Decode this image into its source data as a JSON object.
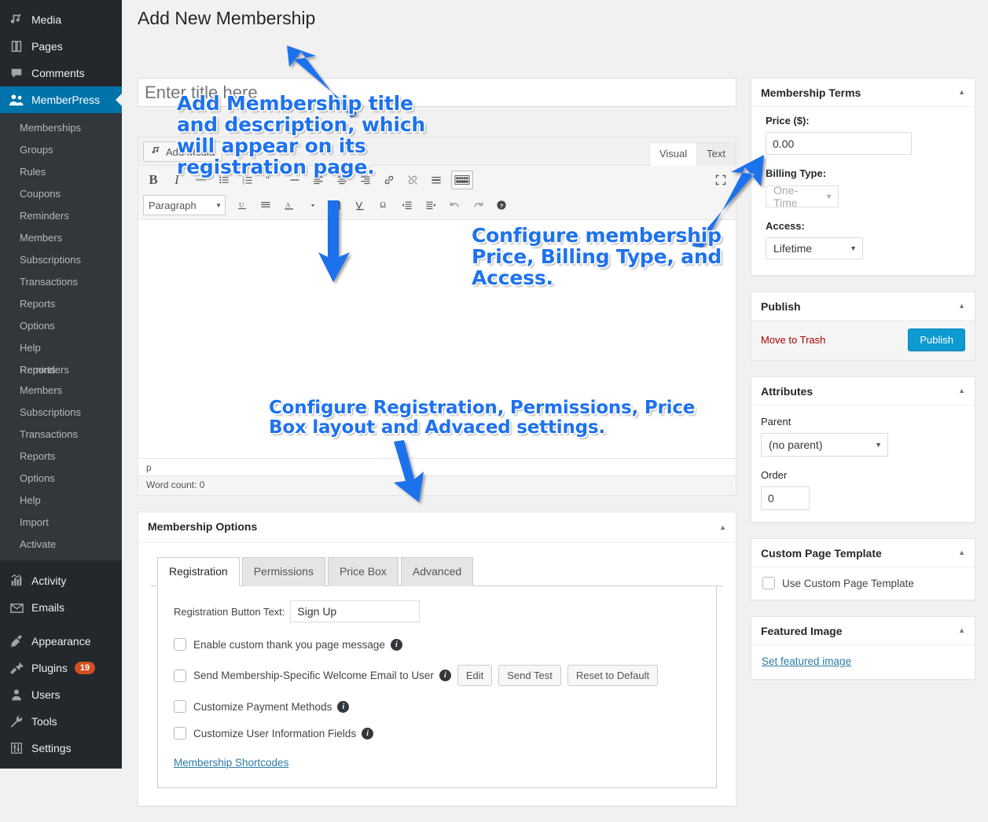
{
  "colors": {
    "sidebar_bg": "#23282d",
    "submenu_bg": "#32373c",
    "accent_blue": "#0073aa",
    "publish_blue": "#0d9bd1",
    "annotation_blue": "#1f72ed",
    "trash_red": "#a00",
    "badge_orange": "#d54e21",
    "link_blue": "#2b7ca6"
  },
  "sidebar": {
    "top_items": [
      {
        "label": "Media",
        "icon": "media-icon",
        "current": false
      },
      {
        "label": "Pages",
        "icon": "pages-icon",
        "current": false
      },
      {
        "label": "Comments",
        "icon": "comments-icon",
        "current": false
      },
      {
        "label": "MemberPress",
        "icon": "memberpress-users-icon",
        "current": true
      }
    ],
    "memberpress_submenu": [
      "Memberships",
      "Groups",
      "Rules",
      "Coupons",
      "Reminders",
      "Members",
      "Subscriptions",
      "Transactions",
      "Reports",
      "Options",
      "Help"
    ],
    "overlap_items": [
      "Reports",
      "Reminders"
    ],
    "memberpress_submenu_tail": [
      "Members",
      "Subscriptions",
      "Transactions",
      "Reports",
      "Options",
      "Help",
      "Import",
      "Activate"
    ],
    "bottom_items": [
      {
        "label": "Activity",
        "icon": "activity-chart-icon",
        "badge": ""
      },
      {
        "label": "Emails",
        "icon": "envelope-icon",
        "badge": ""
      },
      {
        "label": "Appearance",
        "icon": "paintbrush-icon",
        "badge": ""
      },
      {
        "label": "Plugins",
        "icon": "plug-icon",
        "badge": "19"
      },
      {
        "label": "Users",
        "icon": "user-icon",
        "badge": ""
      },
      {
        "label": "Tools",
        "icon": "wrench-icon",
        "badge": ""
      },
      {
        "label": "Settings",
        "icon": "sliders-icon",
        "badge": ""
      }
    ]
  },
  "page": {
    "title": "Add New Membership"
  },
  "title_field": {
    "placeholder": "Enter title here",
    "value": ""
  },
  "editor": {
    "add_media_label": "Add Media",
    "tabs": [
      {
        "label": "Visual",
        "active": true
      },
      {
        "label": "Text",
        "active": false
      }
    ],
    "format_select": "Paragraph",
    "path": "p",
    "word_count": "Word count: 0"
  },
  "membership_terms": {
    "title": "Membership Terms",
    "price_label": "Price ($):",
    "price_value": "0.00",
    "billing_type_label": "Billing Type:",
    "billing_type_value": "One-Time",
    "billing_type_disabled": true,
    "access_label": "Access:",
    "access_value": "Lifetime"
  },
  "publish_box": {
    "title": "Publish",
    "trash_label": "Move to Trash",
    "publish_label": "Publish"
  },
  "attributes_box": {
    "title": "Attributes",
    "parent_label": "Parent",
    "parent_value": "(no parent)",
    "order_label": "Order",
    "order_value": "0"
  },
  "custom_page_template_box": {
    "title": "Custom Page Template",
    "checkbox_label": "Use Custom Page Template",
    "checked": false
  },
  "featured_image_box": {
    "title": "Featured Image",
    "link_label": "Set featured image"
  },
  "membership_options": {
    "title": "Membership Options",
    "tabs": [
      {
        "label": "Registration",
        "active": true
      },
      {
        "label": "Permissions",
        "active": false
      },
      {
        "label": "Price Box",
        "active": false
      },
      {
        "label": "Advanced",
        "active": false
      }
    ],
    "registration_button_text_label": "Registration Button Text:",
    "registration_button_text_value": "Sign Up",
    "checkboxes": [
      {
        "label": "Enable custom thank you page message",
        "checked": false,
        "has_info": true,
        "buttons": []
      },
      {
        "label": "Send Membership-Specific Welcome Email to User",
        "checked": false,
        "has_info": true,
        "buttons": [
          "Edit",
          "Send Test",
          "Reset to Default"
        ]
      },
      {
        "label": "Customize Payment Methods",
        "checked": false,
        "has_info": true,
        "buttons": []
      },
      {
        "label": "Customize User Information Fields",
        "checked": false,
        "has_info": true,
        "buttons": []
      }
    ],
    "shortcodes_link": "Membership Shortcodes"
  },
  "annotations": [
    {
      "id": "annotation-title-description",
      "text": "Add Membership title\nand description, which\nwill appear on its\nregistration page."
    },
    {
      "id": "annotation-terms",
      "text": "Configure membership\nPrice, Billing Type, and\nAccess."
    },
    {
      "id": "annotation-options",
      "text": "Configure Registration, Permissions, Price\nBox layout and Advaced settings."
    }
  ]
}
